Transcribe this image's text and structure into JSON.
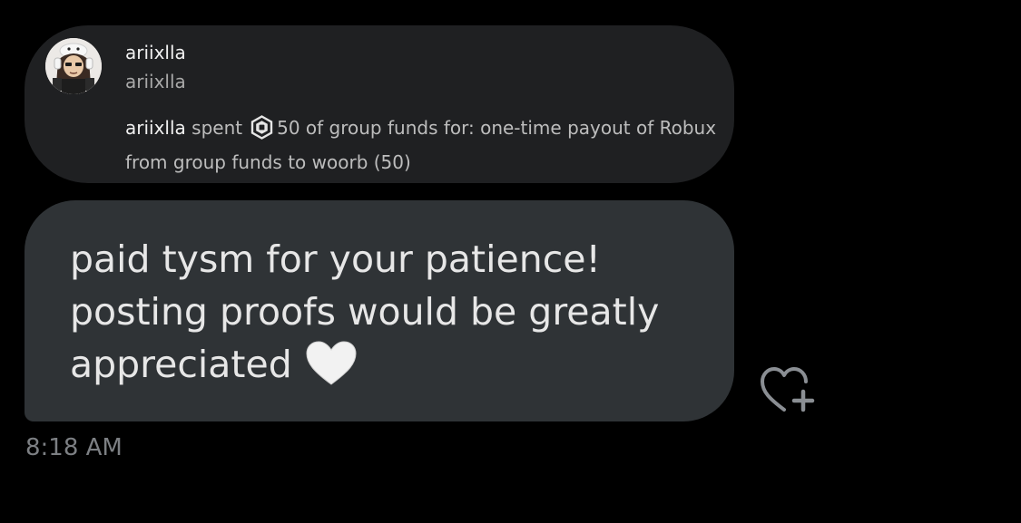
{
  "quote": {
    "username": "ariixlla",
    "handle": "ariixlla",
    "activity": {
      "actor": "ariixlla",
      "verb": "spent",
      "amount": "50",
      "description": "of group funds for: one-time payout of Robux from group funds to woorb (50)"
    },
    "icon": "robux-icon"
  },
  "message": {
    "text": "paid tysm for your patience! posting proofs would be greatly appreciated",
    "emoji": "white-heart-icon"
  },
  "react_icon": "heart-plus-icon",
  "timestamp": "8:18 AM",
  "colors": {
    "background": "#000000",
    "quote_card": "#1f2022",
    "bubble": "#2f3336",
    "timestamp": "#7c7f83"
  }
}
